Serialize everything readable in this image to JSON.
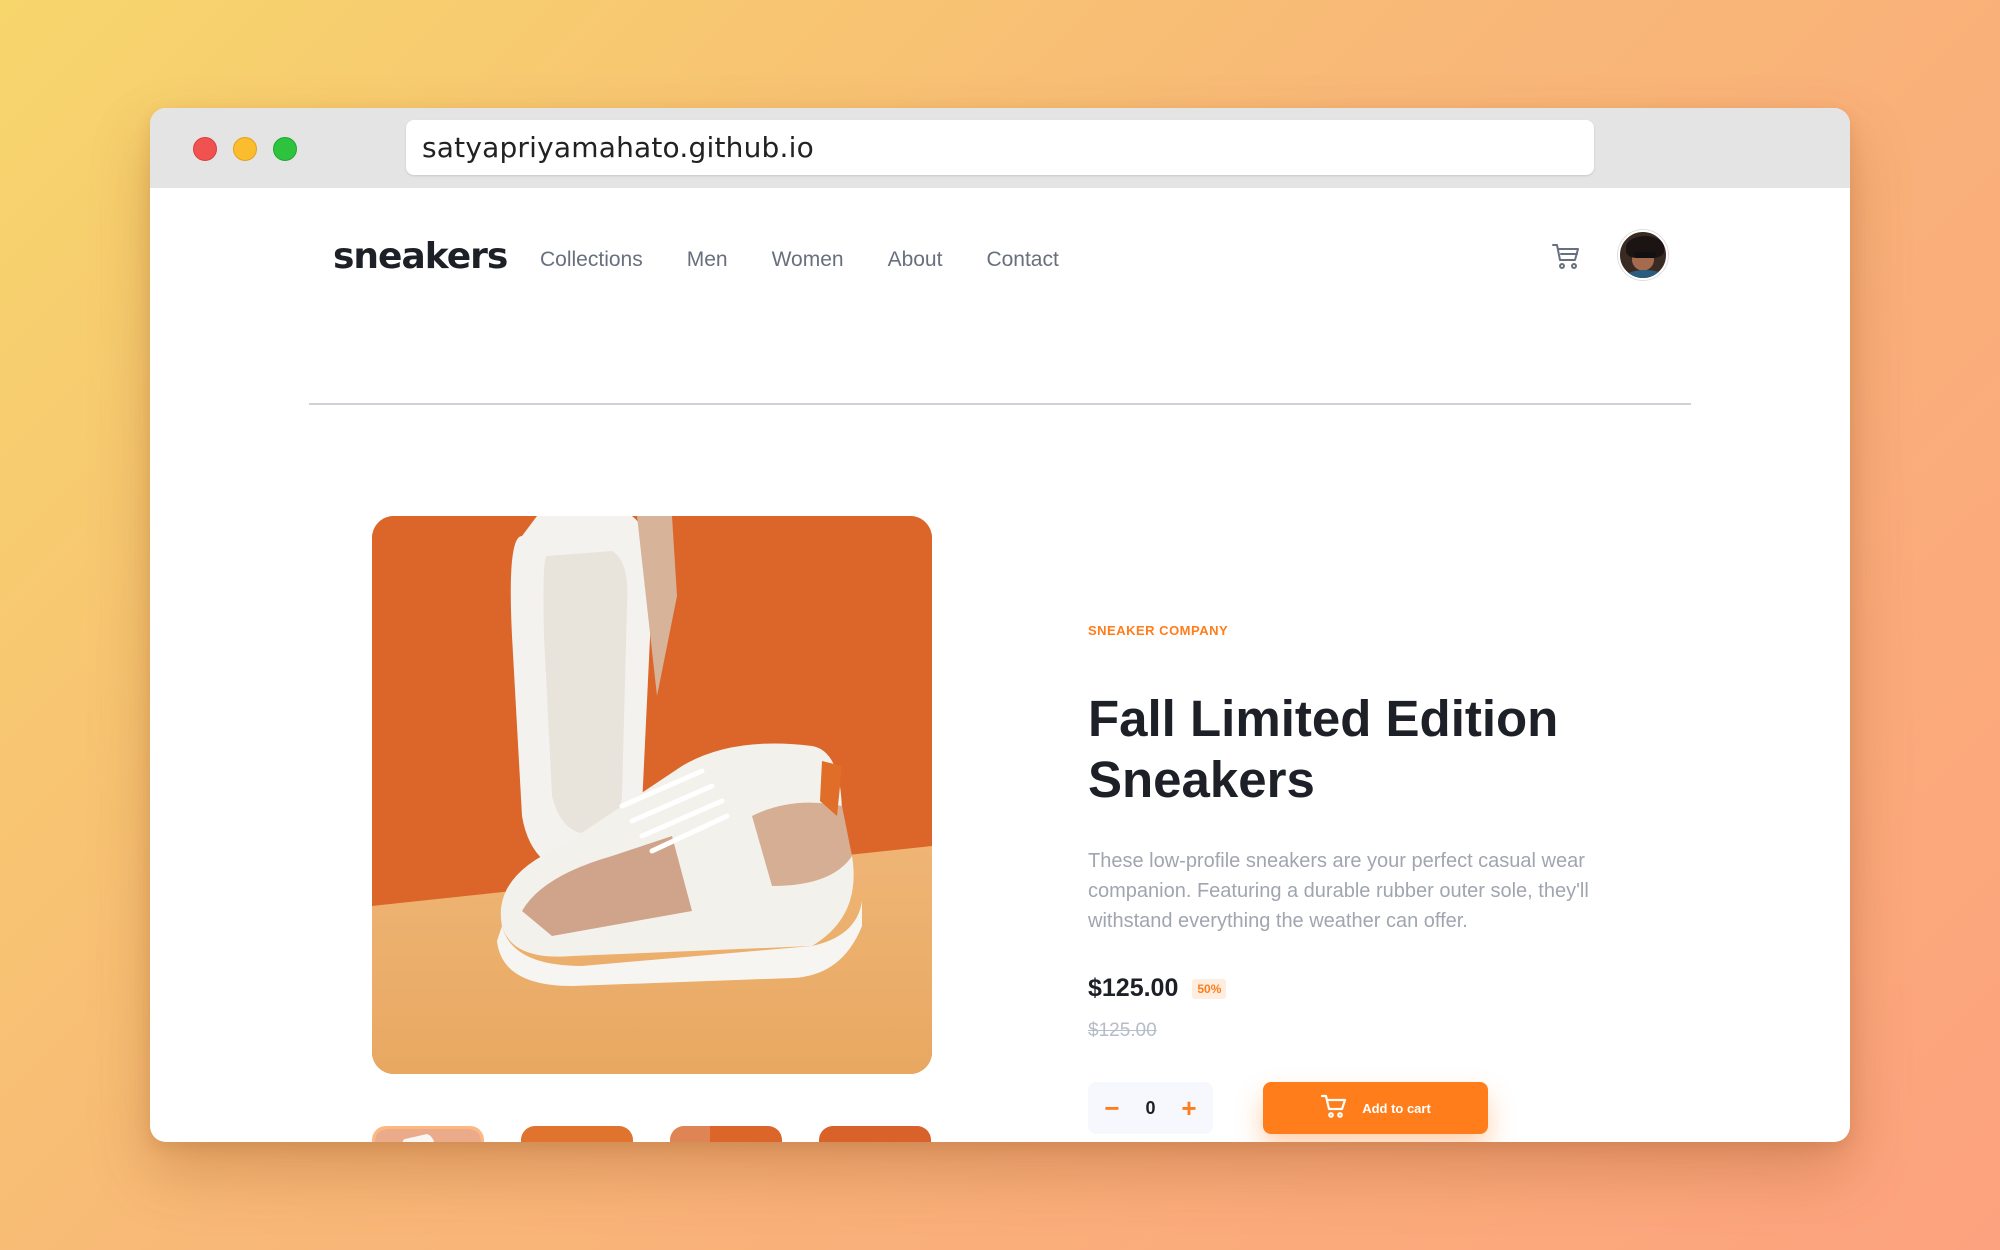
{
  "browser": {
    "url": "satyapriyamahato.github.io"
  },
  "header": {
    "logo": "sneakers",
    "nav": [
      "Collections",
      "Men",
      "Women",
      "About",
      "Contact"
    ],
    "cart_icon": "cart-icon",
    "avatar_icon": "user-avatar"
  },
  "product": {
    "company": "SNEAKER COMPANY",
    "title": "Fall Limited Edition Sneakers",
    "description": "These low-profile sneakers are your perfect casual wear companion. Featuring a durable rubber outer sole, they'll withstand everything the weather can offer.",
    "price": "$125.00",
    "discount": "50%",
    "original_price": "$125.00",
    "quantity": "0",
    "minus": "−",
    "plus": "+",
    "add_to_cart": "Add to cart"
  },
  "colors": {
    "accent": "#ff7d1a",
    "text_dark": "#1d2026",
    "text_muted": "#69707d"
  }
}
